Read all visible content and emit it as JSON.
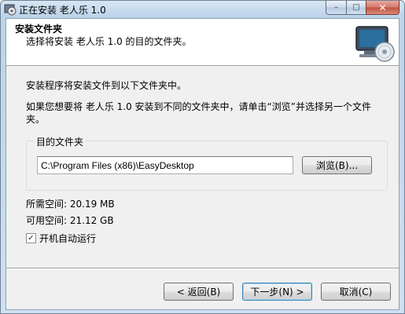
{
  "window": {
    "title": "正在安装 老人乐 1.0",
    "icons": {
      "app": "installer-disc-icon",
      "header": "monitor-disc-icon"
    }
  },
  "caption": {
    "minimize": "–",
    "maximize": "□",
    "close": "✕"
  },
  "header": {
    "title": "安装文件夹",
    "subtitle": "选择将安装 老人乐 1.0 的目的文件夹。"
  },
  "body": {
    "line1": "安装程序将安装文件到以下文件夹中。",
    "line2": "如果您想要将 老人乐 1.0 安装到不同的文件夹中，请单击“浏览”并选择另一个文件夹。"
  },
  "destination": {
    "group_label": "目的文件夹",
    "path": "C:\\Program Files (x86)\\EasyDesktop",
    "browse_label": "浏览(B)..."
  },
  "space": {
    "required": "所需空间: 20.19 MB",
    "available": "可用空间: 21.12 GB"
  },
  "autorun": {
    "label": "开机自动运行",
    "checked": true,
    "check_mark": "✓"
  },
  "buttons": {
    "back": "< 返回(B)",
    "next": "下一步(N) >",
    "cancel": "取消(C)"
  }
}
